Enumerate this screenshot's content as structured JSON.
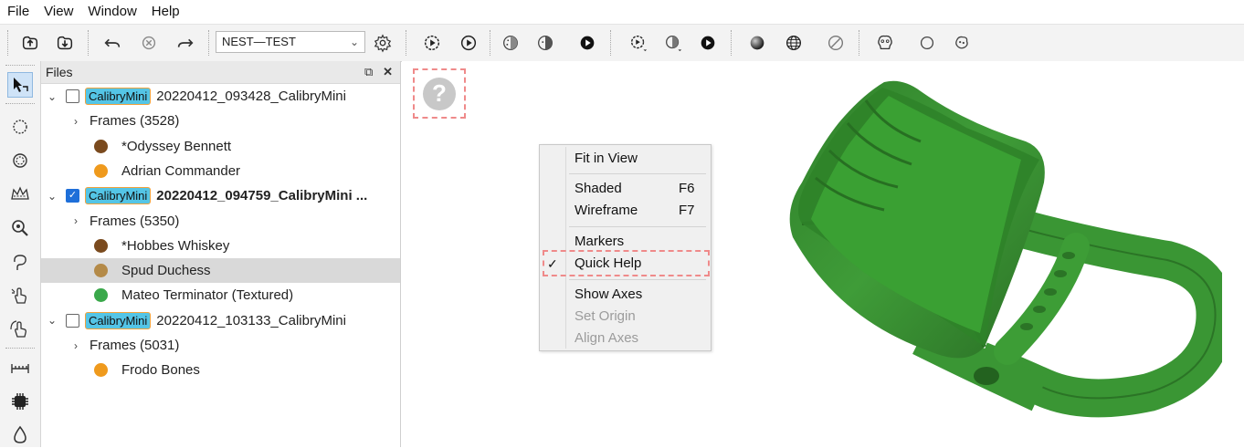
{
  "menu": [
    "File",
    "View",
    "Window",
    "Help"
  ],
  "toolbar": {
    "combo_value": "NEST—TEST",
    "icons": [
      "import-icon",
      "export-icon",
      "undo-icon",
      "cancel-icon",
      "redo-icon",
      "settings-icon",
      "play-circle-icon",
      "play-icon",
      "point-cloud-icon",
      "point-cloud-alt-icon",
      "record-icon",
      "play-dropdown-icon",
      "cloud-dropdown-icon",
      "record-alt-icon",
      "sphere-icon",
      "globe-icon",
      "no-icon",
      "mesh-tool-icon",
      "circle-icon",
      "shape-icon"
    ]
  },
  "left_tools": [
    "select-tool-icon",
    "circle-select-icon",
    "lasso-icon",
    "crown-icon",
    "search-zoom-icon",
    "lasso-draw-icon",
    "hand-point-icon",
    "hand-rotate-icon",
    "measure-icon",
    "chip-icon",
    "drop-icon"
  ],
  "files": {
    "title": "Files",
    "rows": [
      {
        "type": "file",
        "checked": false,
        "tag": "CalibryMini",
        "name": "20220412_093428_CalibryMini",
        "bold": false
      },
      {
        "type": "frames",
        "label": "Frames (3528)"
      },
      {
        "type": "item",
        "color": "#7a4a1e",
        "label": "*Odyssey Bennett"
      },
      {
        "type": "item",
        "color": "#ef9a1d",
        "label": "Adrian Commander"
      },
      {
        "type": "file",
        "checked": true,
        "tag": "CalibryMini",
        "name": "20220412_094759_CalibryMini ...",
        "bold": true
      },
      {
        "type": "frames",
        "label": "Frames (5350)"
      },
      {
        "type": "item",
        "color": "#7a4a1e",
        "label": "*Hobbes Whiskey"
      },
      {
        "type": "item",
        "color": "#b48a48",
        "label": "Spud Duchess",
        "selected": true
      },
      {
        "type": "item",
        "color": "#3aa84a",
        "label": "Mateo Terminator (Textured)"
      },
      {
        "type": "file",
        "checked": false,
        "tag": "CalibryMini",
        "name": "20220412_103133_CalibryMini",
        "bold": false
      },
      {
        "type": "frames",
        "label": "Frames (5031)"
      },
      {
        "type": "item",
        "color": "#ef9a1d",
        "label": "Frodo Bones"
      }
    ]
  },
  "context_menu": {
    "items": [
      {
        "label": "Fit in View",
        "key": "",
        "disabled": false,
        "checked": false
      },
      {
        "label": "Shaded",
        "key": "F6",
        "disabled": false,
        "checked": false
      },
      {
        "label": "Wireframe",
        "key": "F7",
        "disabled": false,
        "checked": false
      },
      {
        "label": "Markers",
        "key": "",
        "disabled": false,
        "checked": false
      },
      {
        "label": "Quick Help",
        "key": "",
        "disabled": false,
        "checked": true
      },
      {
        "label": "Show Axes",
        "key": "",
        "disabled": false,
        "checked": false
      },
      {
        "label": "Set Origin",
        "key": "",
        "disabled": true,
        "checked": false
      },
      {
        "label": "Align Axes",
        "key": "",
        "disabled": true,
        "checked": false
      }
    ]
  },
  "viewport": {
    "model_color": "#3c9a36"
  }
}
